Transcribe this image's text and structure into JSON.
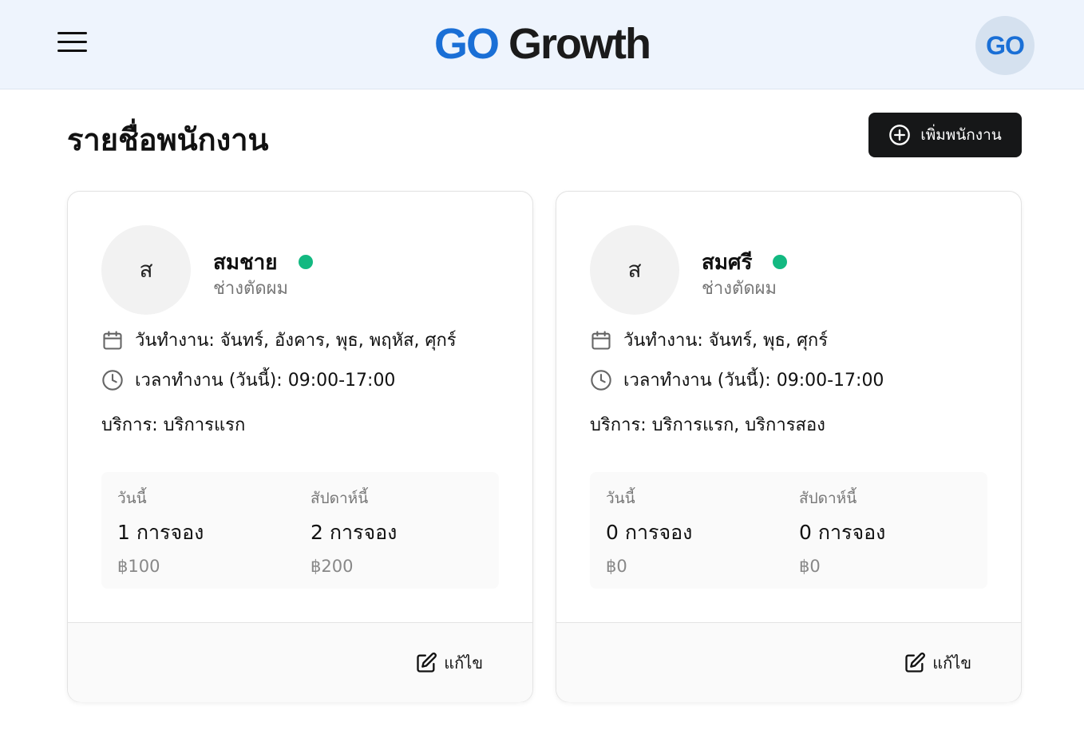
{
  "header": {
    "logo_go": "GO",
    "logo_growth": "Growth",
    "avatar_text": "GO"
  },
  "page": {
    "title": "รายชื่อพนักงาน",
    "add_button_label": "เพิ่มพนักงาน"
  },
  "colors": {
    "brand_blue": "#1a6fd6",
    "status_active": "#13b981",
    "primary_button": "#161718",
    "header_bg": "#eef4fd"
  },
  "icons": {
    "menu": "hamburger-icon",
    "add": "plus-circle-icon",
    "days": "calendar-icon",
    "hours": "clock-icon",
    "edit": "edit-icon"
  },
  "staff": [
    {
      "initial": "ส",
      "name": "สมชาย",
      "role": "ช่างตัดผม",
      "status": "active",
      "days_text": "วันทำงาน: จันทร์, อังคาร, พุธ, พฤหัส, ศุกร์",
      "hours_text": "เวลาทำงาน (วันนี้): 09:00-17:00",
      "services_text": "บริการ: บริการแรก",
      "today_label": "วันนี้",
      "today_bookings": "1 การจอง",
      "today_amount": "฿100",
      "week_label": "สัปดาห์นี้",
      "week_bookings": "2 การจอง",
      "week_amount": "฿200",
      "edit_label": "แก้ไข"
    },
    {
      "initial": "ส",
      "name": "สมศรี",
      "role": "ช่างตัดผม",
      "status": "active",
      "days_text": "วันทำงาน: จันทร์, พุธ, ศุกร์",
      "hours_text": "เวลาทำงาน (วันนี้): 09:00-17:00",
      "services_text": "บริการ: บริการแรก, บริการสอง",
      "today_label": "วันนี้",
      "today_bookings": "0 การจอง",
      "today_amount": "฿0",
      "week_label": "สัปดาห์นี้",
      "week_bookings": "0 การจอง",
      "week_amount": "฿0",
      "edit_label": "แก้ไข"
    }
  ]
}
